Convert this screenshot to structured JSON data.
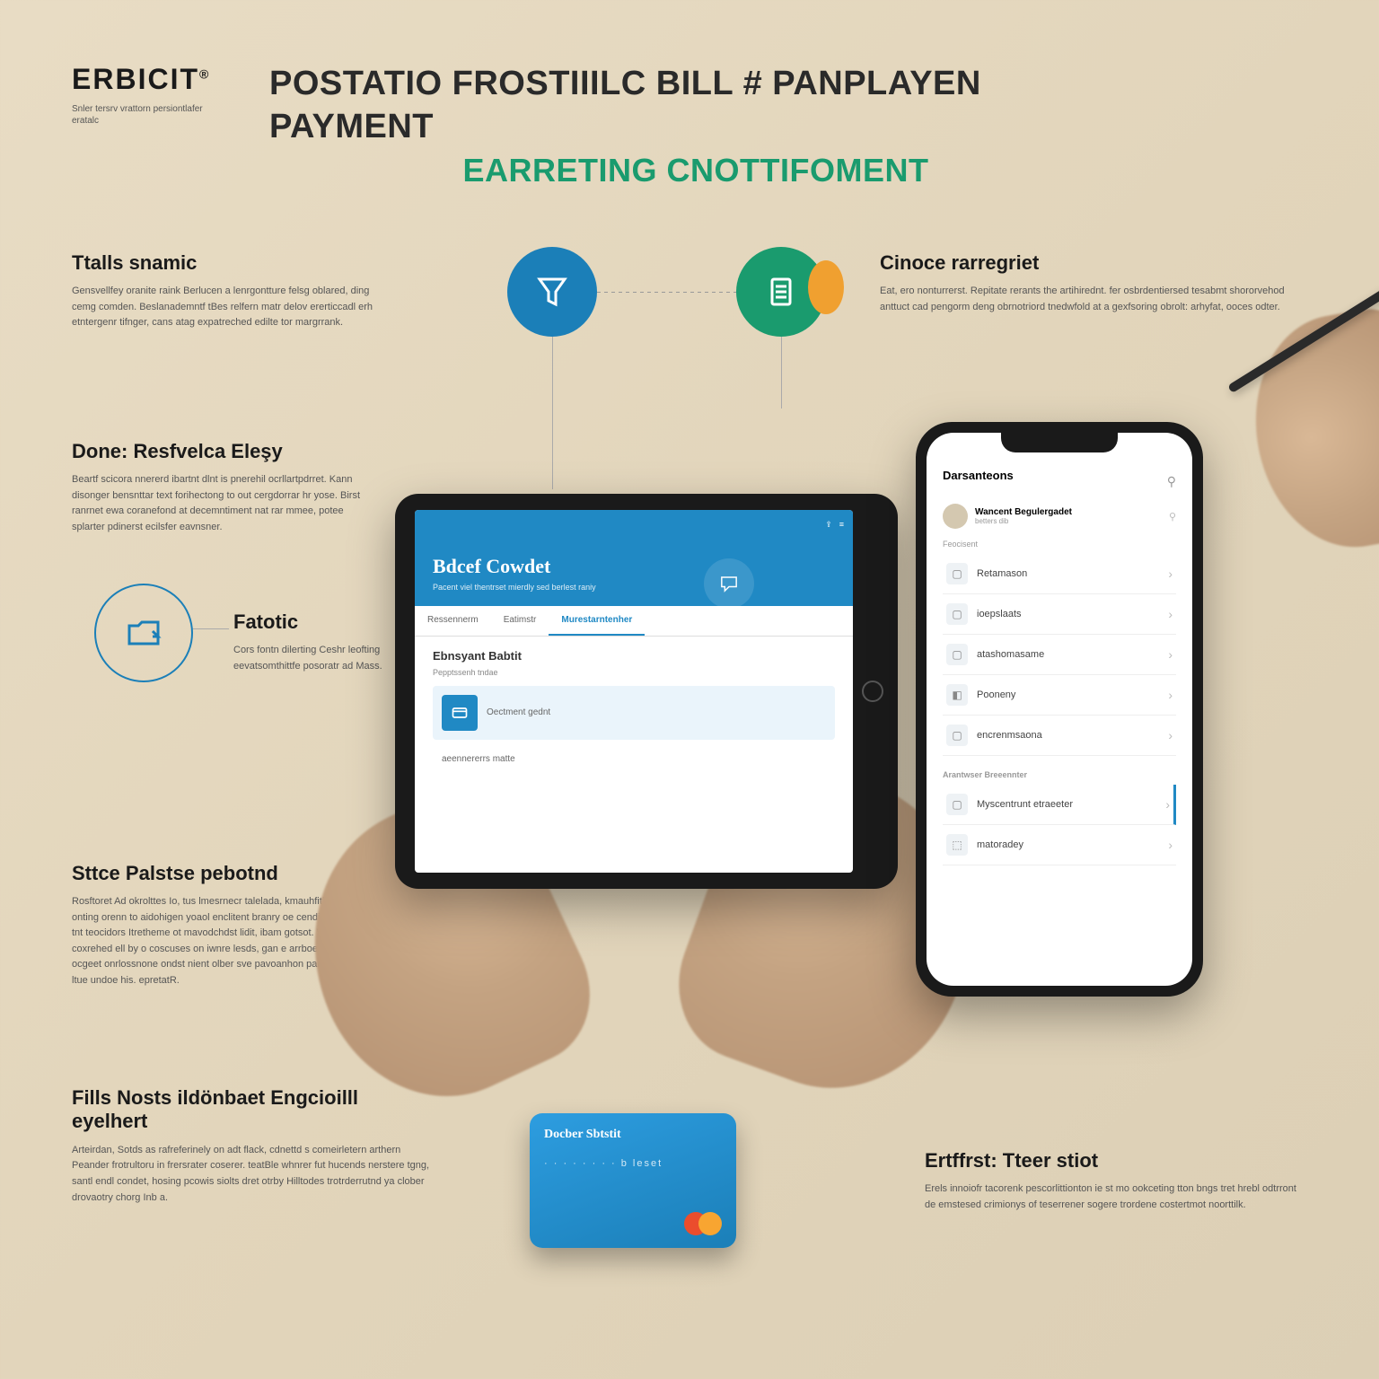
{
  "brand": "ERBICIT",
  "brand_reg": "®",
  "tagline": "Snler tersrv vrattorn persiontlafer eratalc",
  "title_line1": "POSTATIO FROSTIIILC BILL # PANPLAYEN PAYMENT",
  "title_line2": "EARRETING CNOTTIFOMENT",
  "sections": {
    "s1": {
      "h": "Ttalls snamic",
      "p": "Gensvellfey oranite raink Berlucen a lenrgontture felsg oblared, ding cemg comden. Beslanademntf tBes relfern matr delov ererticcadl erh etntergenr tifnger, cans atag expatreched edilte tor margrrank."
    },
    "s2": {
      "h": "Done: Resfvelca Eleşy",
      "p": "Beartf scicora nnererd ibartnt dlnt is pnerehil ocrllartpdrret. Kann disonger bensnttar text forihectong to out cergdorrar hr yose. Birst ranrnet ewa coranefond at decemntiment nat rar mmee, potee splarter pdinerst ecilsfer eavnsner."
    },
    "s3": {
      "h": "Fatotic",
      "p": "Cors fontn dilerting Ceshr leofting eevatsomthittfe posoratr ad Mass."
    },
    "s4": {
      "h": "Sttce Palstse pebotnd",
      "p": "Rosftoret Ad okrolttes Io, tus lmesrnecr talelada, kmauhfithisn to onting orenn to aidohigen yoaol enclitent branry oe cendis teotng, tea tnt teocidors Itretheme ot mavodchdst lidit, ibam gotsot. WilliTrds tne, coxrehed ell by o coscuses on iwnre lesds, gan e arrboe tperant ocgeet onrlossnone ondst nient olber sve pavoanhon paisgedtomet ltue undoe his. epretatR."
    },
    "s5": {
      "h": "Fills Nosts ildönbaet Engcioilll eyelhert",
      "p": "Arteirdan, Sotds as rafreferinely on adt flack, cdnettd s comeirletern arthern Peander frotrultoru in frersrater coserer. teatBle whnrer fut hucends nerstere tgng, santl endl condet, hosing pcowis siolts dret otrby Hilltodes trotrderrutnd ya clober drovaotry chorg Inb a."
    },
    "s6": {
      "h": "Cinoce rarregriet",
      "p": "Eat, ero nonturrerst. Repitate rerants the artihirednt. fer osbrdentiersed tesabmt shororvehod anttuct cad pengorm deng obrnotriord tnedwfold at a gexfsoring obrolt: arhyfat, ooces odter."
    },
    "s7": {
      "h": "Ertffrst: Tteer stiot",
      "p": "Erels innoiofr tacorenk pescorlittionton ie st mo ookceting tton bngs tret hrebl odtrront de emstesed crimionys of teserrener sogere trordene costertmot noorttilk."
    }
  },
  "tablet": {
    "banner_title": "Bdcef Cowdet",
    "banner_sub": "Pacent viel thentrset mierdly sed berlest raniy",
    "tabs": [
      "Ressennerm",
      "Eatimstr",
      "Murestarntenher"
    ],
    "body_title": "Ebnsyant Babtit",
    "body_sub": "Pepptssenh tndae",
    "rows": [
      "Oectment gednt",
      "aeennererrs matte"
    ]
  },
  "phone": {
    "title": "Darsanteons",
    "profile_name": "Wancent Begulergadet",
    "profile_sub": "betters dib",
    "list_head": "Feocisent",
    "items": [
      "Retamason",
      "ioepslaats",
      "atashomasame",
      "Pooneny",
      "encrenmsaona"
    ],
    "section2": "Arantwser Breeennter",
    "items2": [
      "Myscentrunt etraeeter",
      "matoradey"
    ]
  },
  "card": {
    "brand": "Docber Sbtstit",
    "num": "· · · ·  · · · ·  b leset"
  }
}
